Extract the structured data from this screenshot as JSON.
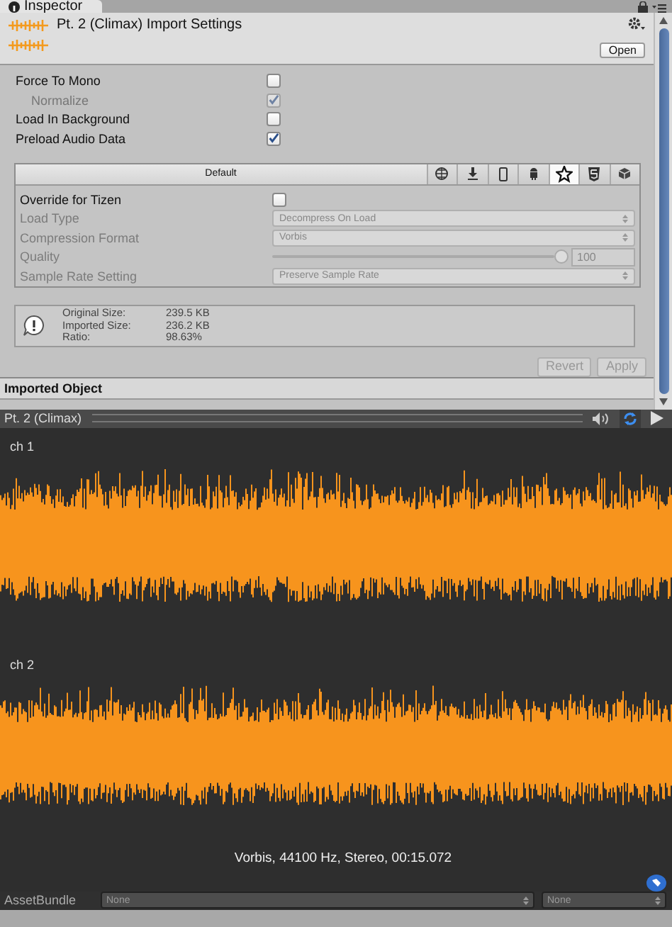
{
  "inspector_tab": {
    "title": "Inspector"
  },
  "header": {
    "title": "Pt. 2 (Climax) Import Settings",
    "open_button": "Open"
  },
  "options": [
    {
      "label": "Force To Mono",
      "checked": false,
      "children": [
        {
          "label": "Normalize",
          "checked": true,
          "disabled": true
        }
      ]
    },
    {
      "label": "Load In Background",
      "checked": false
    },
    {
      "label": "Preload Audio Data",
      "checked": true
    }
  ],
  "platform": {
    "default_tab": "Default",
    "tabs": [
      {
        "kind": "globe",
        "selected": false
      },
      {
        "kind": "download",
        "selected": false
      },
      {
        "kind": "phone",
        "selected": false
      },
      {
        "kind": "android",
        "selected": false
      },
      {
        "kind": "tizen",
        "selected": true
      },
      {
        "kind": "html5",
        "selected": false
      },
      {
        "kind": "box",
        "selected": false
      }
    ],
    "override": {
      "label": "Override for Tizen",
      "checked": false
    },
    "settings": [
      {
        "kind": "dropdown",
        "label": "Load Type",
        "value": "Decompress On Load"
      },
      {
        "kind": "dropdown",
        "label": "Compression Format",
        "value": "Vorbis"
      },
      {
        "kind": "slider",
        "label": "Quality",
        "level": 1,
        "value": "100"
      },
      {
        "kind": "dropdown",
        "label": "Sample Rate Setting",
        "value": "Preserve Sample Rate"
      }
    ]
  },
  "info": [
    {
      "label": "Original Size:",
      "value": "239.5 KB"
    },
    {
      "label": "Imported Size:",
      "value": "236.2 KB"
    },
    {
      "label": "Ratio:",
      "value": "98.63%"
    }
  ],
  "buttons": [
    {
      "label": "Revert",
      "disabled": true
    },
    {
      "label": "Apply",
      "disabled": true
    }
  ],
  "imported_object": {
    "title": "Imported Object"
  },
  "preview": {
    "title": "Pt. 2 (Climax)",
    "loop_on": true,
    "channels": [
      {
        "label": "ch 1"
      },
      {
        "label": "ch 2"
      }
    ],
    "info": "Vorbis, 44100 Hz, Stereo, 00:15.072"
  },
  "asset_bundle": {
    "label": "AssetBundle",
    "name": "None",
    "variant": "None"
  }
}
